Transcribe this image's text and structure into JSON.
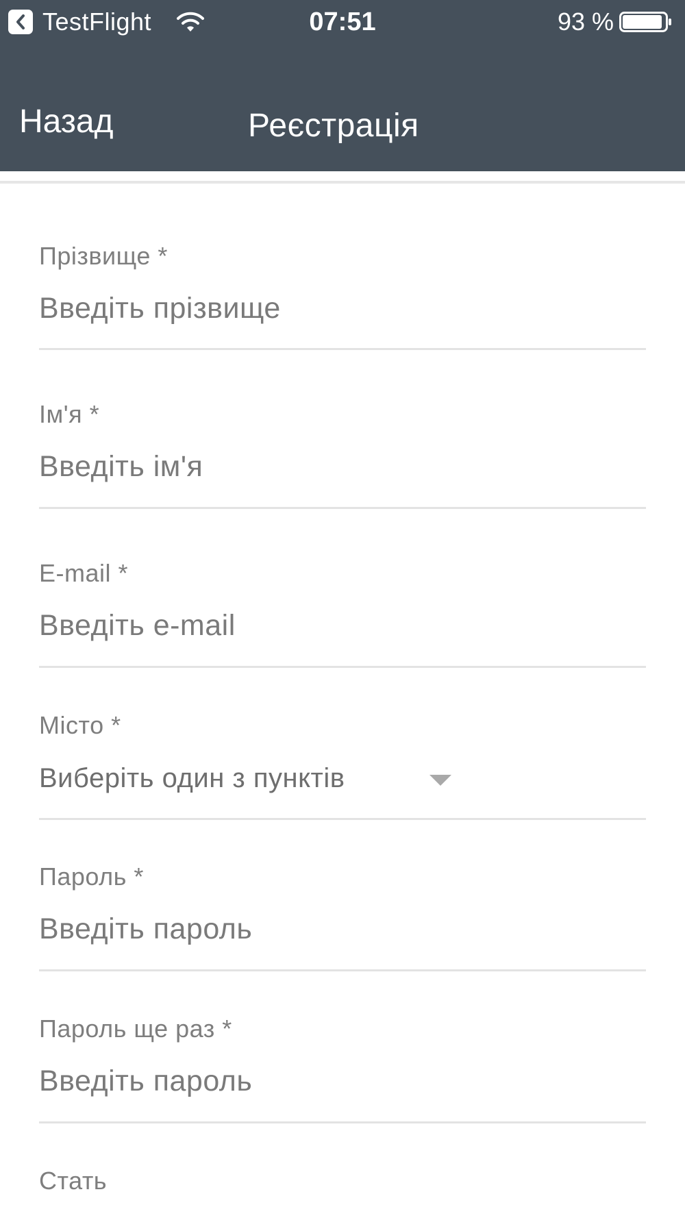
{
  "status_bar": {
    "back_app": "TestFlight",
    "time": "07:51",
    "battery": "93 %",
    "icons": {
      "back": "chevron-left-icon",
      "wifi": "wifi-icon",
      "battery": "battery-icon"
    }
  },
  "nav": {
    "back_label": "Назад",
    "title": "Реєстрація"
  },
  "form": {
    "last_name": {
      "label": "Прізвище *",
      "placeholder": "Введіть прізвище"
    },
    "first_name": {
      "label": "Ім'я *",
      "placeholder": "Введіть ім'я"
    },
    "email": {
      "label": "E-mail *",
      "placeholder": "Введіть e-mail"
    },
    "city": {
      "label": "Місто *",
      "selected": "Виберіть один з пунктів"
    },
    "password": {
      "label": "Пароль *",
      "placeholder": "Введіть пароль"
    },
    "password_repeat": {
      "label": "Пароль ще раз *",
      "placeholder": "Введіть пароль"
    },
    "gender": {
      "label": "Стать"
    }
  },
  "colors": {
    "header_bg": "#45505b",
    "label": "#7e7e7e",
    "placeholder": "#7a7a7a",
    "divider": "#e3e3e3"
  }
}
